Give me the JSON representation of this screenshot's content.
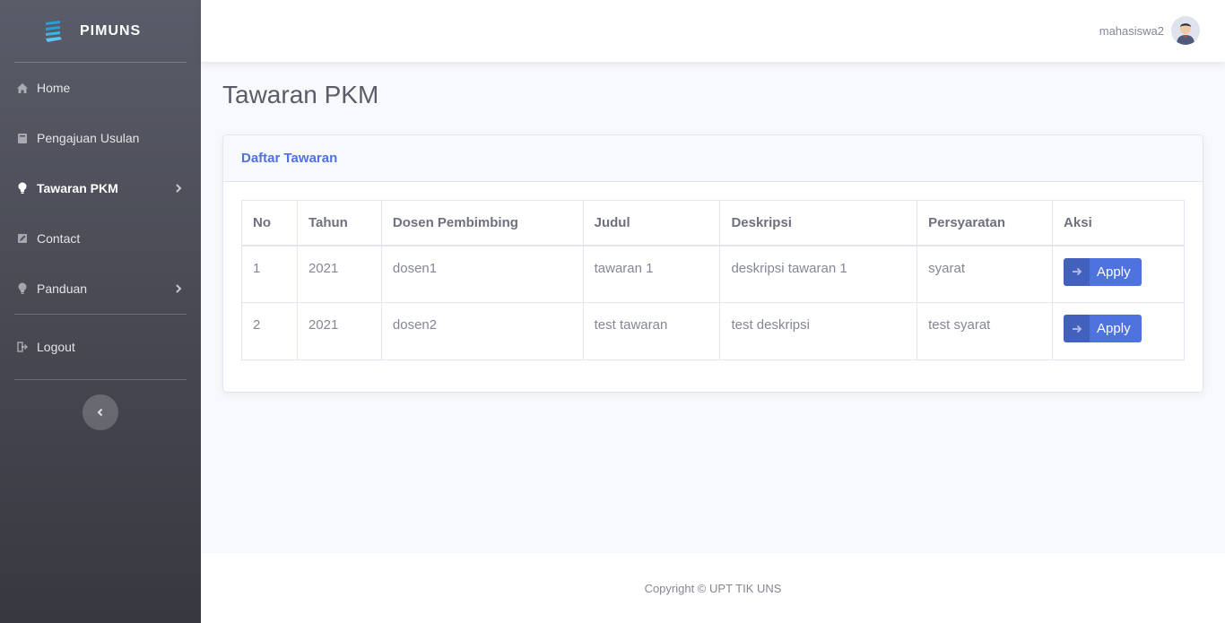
{
  "brand": {
    "name": "PIMUNS"
  },
  "sidebar": {
    "items": [
      {
        "label": "Home",
        "icon": "home-icon"
      },
      {
        "label": "Pengajuan Usulan",
        "icon": "book-icon"
      },
      {
        "label": "Tawaran PKM",
        "icon": "lightbulb-icon",
        "active": true
      },
      {
        "label": "Contact",
        "icon": "edit-icon"
      },
      {
        "label": "Panduan",
        "icon": "lightbulb-icon"
      }
    ],
    "logout": "Logout"
  },
  "topbar": {
    "username": "mahasiswa2"
  },
  "page": {
    "title": "Tawaran PKM"
  },
  "card": {
    "header": "Daftar Tawaran",
    "columns": [
      "No",
      "Tahun",
      "Dosen Pembimbing",
      "Judul",
      "Deskripsi",
      "Persyaratan",
      "Aksi"
    ],
    "rows": [
      {
        "no": "1",
        "tahun": "2021",
        "dosen": "dosen1",
        "judul": "tawaran 1",
        "deskripsi": "deskripsi tawaran 1",
        "persyaratan": "syarat",
        "aksi": "Apply"
      },
      {
        "no": "2",
        "tahun": "2021",
        "dosen": "dosen2",
        "judul": "test tawaran",
        "deskripsi": "test deskripsi",
        "persyaratan": "test syarat",
        "aksi": "Apply"
      }
    ]
  },
  "footer": {
    "text": "Copyright © UPT TIK UNS"
  },
  "colors": {
    "primary": "#4e73df",
    "sidebar": "#4a4b55"
  }
}
